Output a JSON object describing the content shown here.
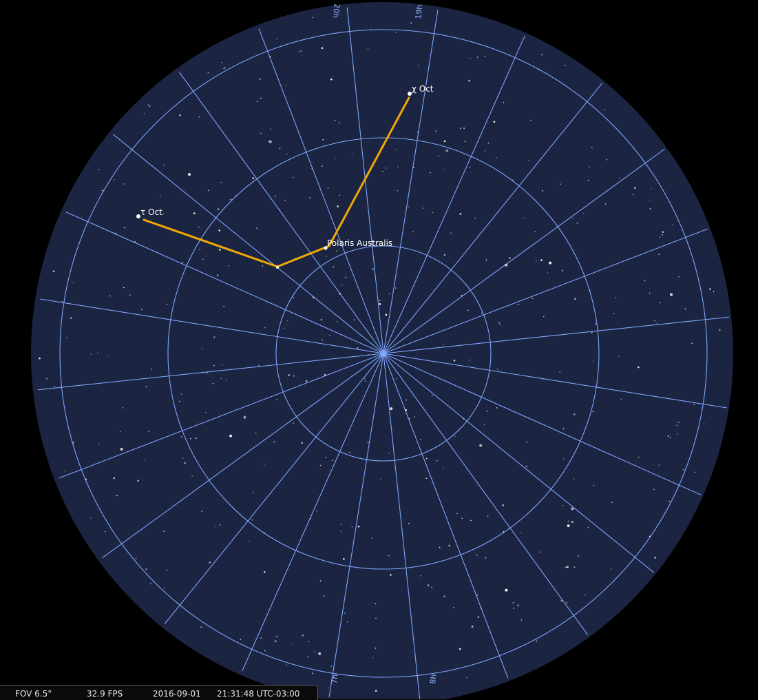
{
  "sky": {
    "background": "#000000",
    "disk_color": "#1b2440",
    "grid_color": "#7fa8ff",
    "constellation_color": "#f0aa00",
    "star_color": "#ffffff"
  },
  "stars_named": [
    {
      "id": "chi-oct",
      "label": "χ Oct"
    },
    {
      "id": "polaris-australis",
      "label": "Polaris Australis"
    },
    {
      "id": "tau-oct",
      "label": "τ Oct"
    }
  ],
  "hour_labels": [
    {
      "id": "20h",
      "text": "20h"
    },
    {
      "id": "19h",
      "text": "19h"
    },
    {
      "id": "7h",
      "text": "7h"
    },
    {
      "id": "8h",
      "text": "8h"
    }
  ],
  "status": {
    "fov": "FOV 6.5°",
    "fps": "32.9 FPS",
    "date": "2016-09-01",
    "time": "21:31:48 UTC-03:00"
  }
}
